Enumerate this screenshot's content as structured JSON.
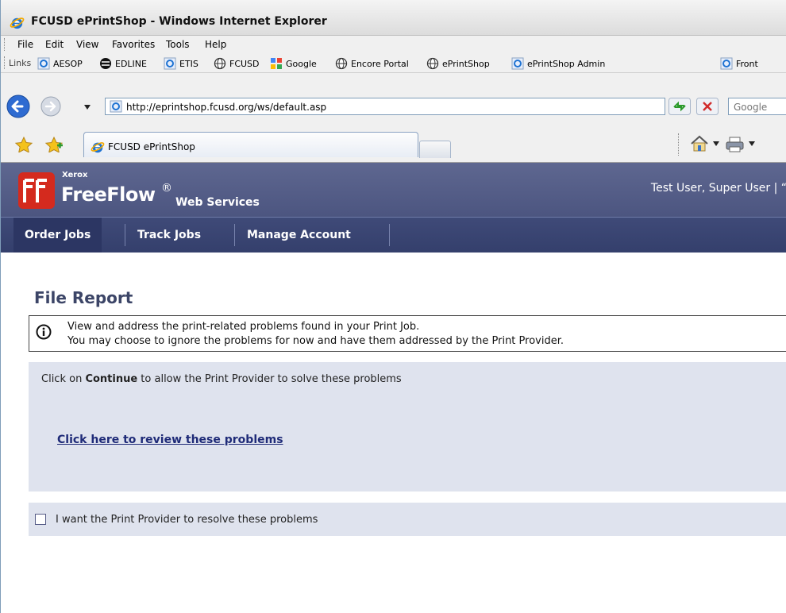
{
  "window": {
    "title": "FCUSD ePrintShop - Windows Internet Explorer"
  },
  "menu": [
    "File",
    "Edit",
    "View",
    "Favorites",
    "Tools",
    "Help"
  ],
  "links_bar": {
    "label": "Links",
    "items": [
      "AESOP",
      "EDLINE",
      "ETIS",
      "FCUSD",
      "Google",
      "Encore Portal",
      "ePrintShop",
      "ePrintShop Admin",
      "Front"
    ]
  },
  "address": {
    "url": "http://eprintshop.fcusd.org/ws/default.asp",
    "search_placeholder": "Google"
  },
  "tab": {
    "title": "FCUSD ePrintShop"
  },
  "banner": {
    "brand_small": "Xerox",
    "brand": "FreeFlow",
    "reg": "®",
    "subtitle": "Web Services",
    "user": "Test User, Super User | “"
  },
  "nav": [
    "Order Jobs",
    "Track Jobs",
    "Manage Account"
  ],
  "content": {
    "heading": "File Report",
    "notice_line1": "View and address the print-related problems found in your Print Job.",
    "notice_line2": "You may choose to ignore the problems for now and have them addressed by the Print Provider.",
    "msg_pre": "Click on ",
    "msg_bold": "Continue",
    "msg_post": " to allow the Print Provider to solve these problems",
    "review_link": "Click here to review these problems",
    "checkbox_label": "I want the Print Provider to resolve these problems"
  },
  "colors": {
    "banner": "#4c5580",
    "nav": "#343f6c",
    "panel": "#dfe3ee",
    "link": "#1f2b78"
  }
}
